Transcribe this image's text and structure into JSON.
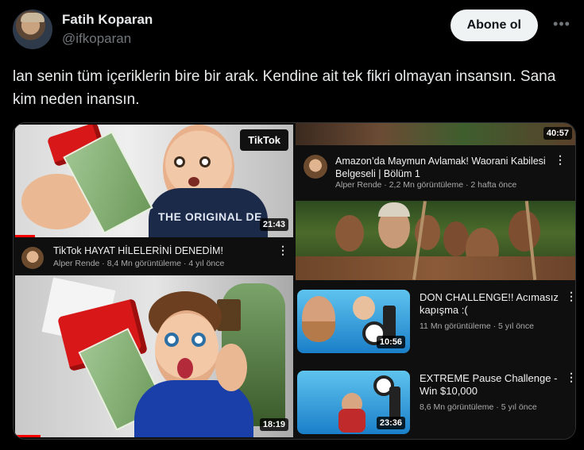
{
  "author": {
    "name": "Fatih Koparan",
    "handle": "@ifkoparan",
    "follow_label": "Abone ol",
    "more_icon": "more-horizontal-icon"
  },
  "tweet": {
    "text": "lan senin tüm içeriklerin bire bir arak. Kendine ait tek fikri olmayan insansın. Sana kim neden inansın."
  },
  "media": {
    "left": {
      "top_video": {
        "badge": "TikTok",
        "duration": "21:43",
        "progress": 0.07,
        "title": "TikTok HAYAT HİLELERİNİ DENEDİM!",
        "meta": "Alper Rende · 8,4 Mn görüntüleme · 4 yıl önce"
      },
      "bottom_video": {
        "duration": "18:19",
        "progress": 0.09
      }
    },
    "right": {
      "top_duration": "40:57",
      "card": {
        "title": "Amazon’da Maymun Avlamak! Waorani Kabilesi Belgeseli | Bölüm 1",
        "meta": "Alper Rende · 2,2 Mn görüntüleme · 2 hafta önce"
      },
      "list": [
        {
          "title": "DON CHALLENGE!! Acımasız kapışma :(",
          "meta": "11 Mn görüntüleme · 5 yıl önce",
          "duration": "10:56"
        },
        {
          "title": "EXTREME Pause Challenge - Win $10,000",
          "meta": "8,6 Mn görüntüleme · 5 yıl önce",
          "duration": "23:36"
        }
      ]
    }
  }
}
